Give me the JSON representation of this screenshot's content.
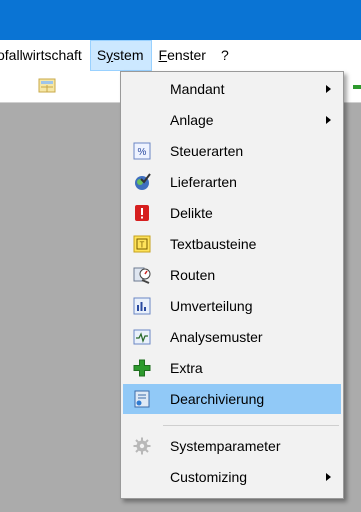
{
  "menubar": {
    "item1": "Abfallwirtschaft",
    "item1_visible": "ofallwirtschaft",
    "system": {
      "label": "System",
      "accel": "y",
      "pre": "S",
      "post": "stem"
    },
    "fenster": {
      "label": "Fenster",
      "accel": "F",
      "post": "enster"
    },
    "help": "?"
  },
  "menu": {
    "items": [
      {
        "label": "Mandant",
        "icon": "none",
        "submenu": true
      },
      {
        "label": "Anlage",
        "icon": "none",
        "submenu": true
      },
      {
        "label": "Steuerarten",
        "icon": "percent-icon"
      },
      {
        "label": "Lieferarten",
        "icon": "globe-check-icon"
      },
      {
        "label": "Delikte",
        "icon": "exclamation-icon"
      },
      {
        "label": "Textbausteine",
        "icon": "text-block-icon"
      },
      {
        "label": "Routen",
        "icon": "route-icon"
      },
      {
        "label": "Umverteilung",
        "icon": "bar-chart-icon"
      },
      {
        "label": "Analysemuster",
        "icon": "line-chart-icon"
      },
      {
        "label": "Extra",
        "icon": "green-plus-icon"
      },
      {
        "label": "Dearchivierung",
        "icon": "archive-icon",
        "highlighted": true
      },
      {
        "label": "Systemparameter",
        "icon": "gear-icon"
      },
      {
        "label": "Customizing",
        "icon": "none",
        "submenu": true
      }
    ]
  },
  "colors": {
    "titlebar": "#0a74d4",
    "menu_highlight": "#91c9f7",
    "background": "#ababab"
  }
}
